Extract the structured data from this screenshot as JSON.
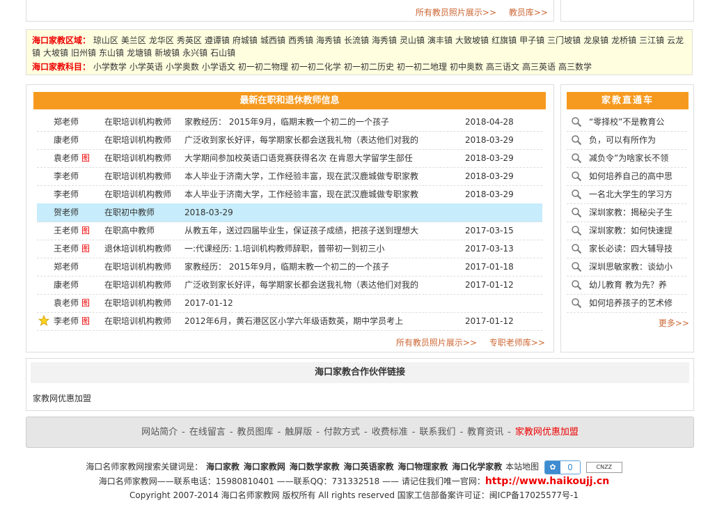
{
  "top": {
    "links": [
      "所有教员照片展示>>",
      "教员库>>"
    ]
  },
  "region": {
    "area_title": "海口家教区域：",
    "areas": [
      "琼山区",
      "美兰区",
      "龙华区",
      "秀英区",
      "遵谭镇",
      "府城镇",
      "城西镇",
      "西秀镇",
      "海秀镇",
      "长流镇",
      "海秀镇",
      "灵山镇",
      "演丰镇",
      "大致坡镇",
      "红旗镇",
      "甲子镇",
      "三门坡镇",
      "龙泉镇",
      "龙桥镇",
      "三江镇",
      "云龙镇",
      "大坡镇",
      "旧州镇",
      "东山镇",
      "龙塘镇",
      "新坡镇",
      "永兴镇",
      "石山镇"
    ],
    "subject_title": "海口家教科目：",
    "subjects": [
      "小学数学",
      "小学英语",
      "小学奥数",
      "小学语文",
      "初一初二物理",
      "初一初二化学",
      "初一初二历史",
      "初一初二地理",
      "初中奥数",
      "高三语文",
      "高三英语",
      "高三数学"
    ]
  },
  "teachers": {
    "title": "最新在职和退休教师信息",
    "photo_mark": "图",
    "rows": [
      {
        "name": "郑老师",
        "photo": false,
        "star": false,
        "type": "在职培训机构教师",
        "desc": "家教经历： 2015年9月，临期末教一个初二的一个孩子",
        "date": "2018-04-28",
        "highlight": false
      },
      {
        "name": "康老师",
        "photo": false,
        "star": false,
        "type": "在职培训机构教师",
        "desc": "广泛收到家长好评，每学期家长都会送我礼物（表达他们对我的",
        "date": "2018-03-29",
        "highlight": false
      },
      {
        "name": "袁老师",
        "photo": true,
        "star": false,
        "type": "在职培训机构教师",
        "desc": "大学期间参加校英语口语竞赛获得名次 在肯恩大学留学生部任",
        "date": "2018-03-29",
        "highlight": false
      },
      {
        "name": "李老师",
        "photo": false,
        "star": false,
        "type": "在职培训机构教师",
        "desc": "本人毕业于济南大学，工作经验丰富，现在武汉鹿城做专职家教",
        "date": "2018-03-29",
        "highlight": false
      },
      {
        "name": "李老师",
        "photo": false,
        "star": false,
        "type": "在职培训机构教师",
        "desc": "本人毕业于济南大学，工作经验丰富，现在武汉鹿城做专职家教",
        "date": "2018-03-29",
        "highlight": false
      },
      {
        "name": "贺老师",
        "photo": false,
        "star": false,
        "type": "在职初中教师",
        "desc": "2018-03-29",
        "date": "",
        "highlight": true
      },
      {
        "name": "王老师",
        "photo": true,
        "star": false,
        "type": "在职高中教师",
        "desc": "从教五年，送过四届毕业生，保证孩子成绩，把孩子送到理想大",
        "date": "2017-03-15",
        "highlight": false
      },
      {
        "name": "王老师",
        "photo": true,
        "star": false,
        "type": "退休培训机构教师",
        "desc": "一:代课经历: 1.培训机构教师辞职，普带初一到初三小",
        "date": "2017-03-13",
        "highlight": false
      },
      {
        "name": "郑老师",
        "photo": false,
        "star": false,
        "type": "在职培训机构教师",
        "desc": "家教经历： 2015年9月，临期末教一个初二的一个孩子",
        "date": "2017-01-18",
        "highlight": false
      },
      {
        "name": "康老师",
        "photo": false,
        "star": false,
        "type": "在职培训机构教师",
        "desc": "广泛收到家长好评，每学期家长都会送我礼物（表达他们对我的",
        "date": "2017-01-12",
        "highlight": false
      },
      {
        "name": "袁老师",
        "photo": true,
        "star": false,
        "type": "在职培训机构教师",
        "desc": "2017-01-12",
        "date": "",
        "highlight": false
      },
      {
        "name": "李老师",
        "photo": true,
        "star": true,
        "type": "在职培训机构教师",
        "desc": "2012年6月，黄石港区区小学六年级语数英，期中学员考上",
        "date": "2017-01-12",
        "highlight": false
      }
    ],
    "footer_links": [
      "所有教员照片展示>>",
      "专职老师库>>"
    ]
  },
  "express": {
    "title": "家教直通车",
    "items": [
      "“零择校”不是教育公",
      "负，可以有所作为",
      "减负令”为啥家长不领",
      "如何培养自己的高中思",
      "一名北大学生的学习方",
      "深圳家教：揭秘尖子生",
      "深圳家教：如何快速提",
      "家长必读：四大辅导技",
      "深圳思敏家教：谈幼小",
      "幼儿教育 教为先？养",
      "如何培养孩子的艺术修"
    ],
    "more": "更多>>"
  },
  "partner": {
    "title": "海口家教合作伙伴链接",
    "link": "家教网优惠加盟"
  },
  "footer_nav": {
    "items": [
      "网站简介",
      "在线留言",
      "教员图库",
      "触屏版",
      "付款方式",
      "收费标准",
      "联系我们",
      "教育资讯",
      "家教网优惠加盟"
    ],
    "separator": "-"
  },
  "bottom": {
    "keywords_label": "海口名师家教网搜索关键词是：",
    "keywords": [
      "海口家教",
      "海口家教网",
      "海口数学家教",
      "海口英语家教",
      "海口物理家教",
      "海口化学家教"
    ],
    "sitemap": "本站地图",
    "baidu_count": "0",
    "cnzz": "CNZZ",
    "contact_text": "海口名师家教网——联系电话：15980810401 ——联系QQ：731332518 —— 请记住我们唯一官网：",
    "site_url": "http://www.haikoujj.cn",
    "copyright": "Copyright 2007-2014 海口名师家教网 版权所有 All rights reserved 国家工信部备案许可证：闽ICP备17025577号-1"
  }
}
